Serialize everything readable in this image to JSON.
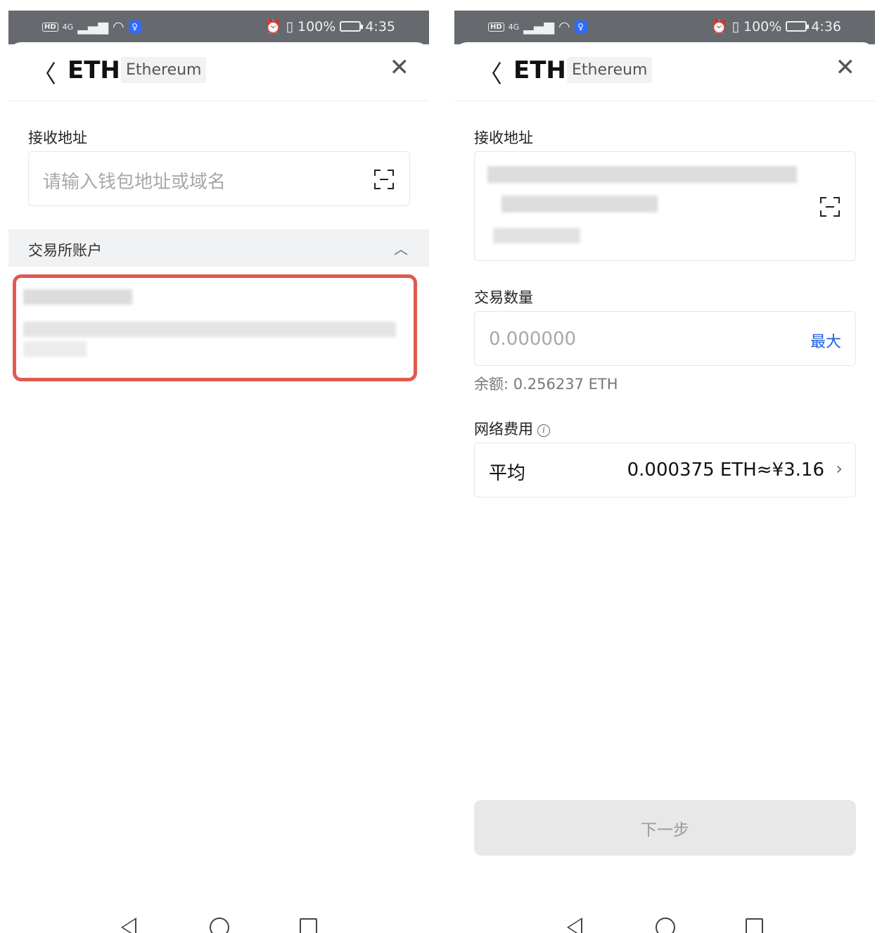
{
  "screens": [
    {
      "status": {
        "network": "4G",
        "battery": "100%",
        "time": "4:35"
      },
      "header": {
        "coin": "ETH",
        "chain": "Ethereum"
      },
      "receive_label": "接收地址",
      "address_placeholder": "请输入钱包地址或域名",
      "exchange_section_title": "交易所账户"
    },
    {
      "status": {
        "network": "4G",
        "battery": "100%",
        "time": "4:36"
      },
      "header": {
        "coin": "ETH",
        "chain": "Ethereum"
      },
      "receive_label": "接收地址",
      "amount_label": "交易数量",
      "amount_placeholder": "0.000000",
      "max_label": "最大",
      "balance_text": "余额: 0.256237 ETH",
      "network_fee_label": "网络费用",
      "fee_option_name": "平均",
      "fee_option_value": "0.000375 ETH≈¥3.16",
      "next_button": "下一步"
    }
  ],
  "icons": {
    "back": "chevron-left-icon",
    "close": "close-icon",
    "scan": "scan-icon",
    "collapse": "chevron-up-icon",
    "info": "info-icon",
    "fee_chevron": "chevron-right-icon"
  },
  "colors": {
    "accent": "#1b5fe0",
    "highlight_border": "#e05a4f",
    "status_bar": "#666a6e",
    "section_bg": "#f1f2f4"
  }
}
